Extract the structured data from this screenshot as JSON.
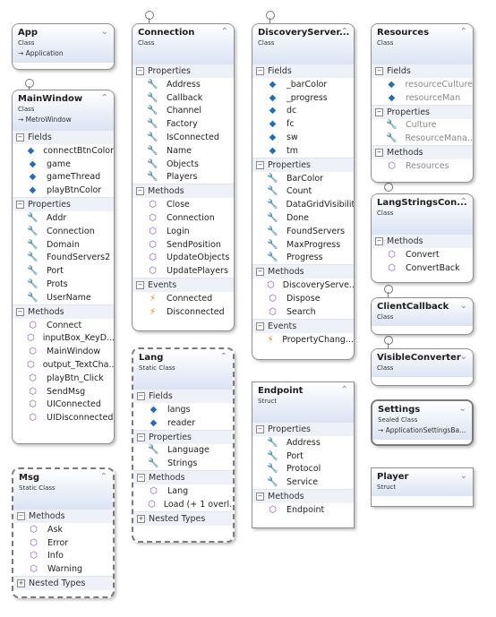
{
  "types": {
    "app": {
      "name": "App",
      "kind": "Class",
      "base": "→ Application",
      "toggle": "⌄"
    },
    "mainwindow": {
      "name": "MainWindow",
      "kind": "Class",
      "base": "→ MetroWindow",
      "toggle": "⌃",
      "fields": [
        "connectBtnColor",
        "game",
        "gameThread",
        "playBtnColor"
      ],
      "properties": [
        "Addr",
        "Connection",
        "Domain",
        "FoundServers2",
        "Port",
        "Prots",
        "UserName"
      ],
      "methods": [
        "Connect",
        "inputBox_KeyD...",
        "MainWindow",
        "output_TextCha...",
        "playBtn_Click",
        "SendMsg",
        "UIConnected",
        "UIDisconnected"
      ]
    },
    "msg": {
      "name": "Msg",
      "kind": "Static Class",
      "toggle": "⌃",
      "methods": [
        "Ask",
        "Error",
        "Info",
        "Warning"
      ]
    },
    "connection": {
      "name": "Connection",
      "kind": "Class",
      "toggle": "⌃",
      "properties": [
        "Address",
        "Callback",
        "Channel",
        "Factory",
        "IsConnected",
        "Name",
        "Objects",
        "Players"
      ],
      "methods": [
        "Close",
        "Connection",
        "Login",
        "SendPosition",
        "UpdateObjects",
        "UpdatePlayers"
      ],
      "events": [
        "Connected",
        "Disconnected"
      ]
    },
    "lang": {
      "name": "Lang",
      "kind": "Static Class",
      "toggle": "⌃",
      "fields": [
        "langs",
        "reader"
      ],
      "properties": [
        "Language",
        "Strings"
      ],
      "methods": [
        "Lang",
        "Load (+ 1 overl..."
      ]
    },
    "discovery": {
      "name": "DiscoveryServer...",
      "kind": "Class",
      "toggle": "⌃",
      "fields": [
        "_barColor",
        "_progress",
        "dc",
        "fc",
        "sw",
        "tm"
      ],
      "properties": [
        "BarColor",
        "Count",
        "DataGridVisibility",
        "Done",
        "FoundServers",
        "MaxProgress",
        "Progress"
      ],
      "methods": [
        "DiscoveryServe...",
        "Dispose",
        "Search"
      ],
      "events": [
        "PropertyChang..."
      ]
    },
    "endpoint": {
      "name": "Endpoint",
      "kind": "Struct",
      "toggle": "⌃",
      "properties": [
        "Address",
        "Port",
        "Protocol",
        "Service"
      ],
      "methods": [
        "Endpoint"
      ]
    },
    "resources": {
      "name": "Resources",
      "kind": "Class",
      "toggle": "⌃",
      "fields": [
        "resourceCulture",
        "resourceMan"
      ],
      "properties": [
        "Culture",
        "ResourceMana..."
      ],
      "methods": [
        "Resources"
      ]
    },
    "langstrings": {
      "name": "LangStringsCon...",
      "kind": "Class",
      "toggle": "⌃",
      "methods": [
        "Convert",
        "ConvertBack"
      ]
    },
    "clientcallback": {
      "name": "ClientCallback",
      "kind": "Class",
      "toggle": "⌄"
    },
    "visibleconverter": {
      "name": "VisibleConverter",
      "kind": "Class",
      "toggle": "⌄"
    },
    "settings": {
      "name": "Settings",
      "kind": "Sealed Class",
      "base": "→ ApplicationSettingsBa...",
      "toggle": "⌄"
    },
    "player": {
      "name": "Player",
      "kind": "Struct",
      "toggle": "⌄"
    }
  },
  "sections": {
    "fields": "Fields",
    "properties": "Properties",
    "methods": "Methods",
    "events": "Events",
    "nested": "Nested Types"
  },
  "icons": {
    "field": "field-icon",
    "property": "wrench-property-icon",
    "method": "method-cube-icon",
    "event": "lightning-event-icon"
  }
}
